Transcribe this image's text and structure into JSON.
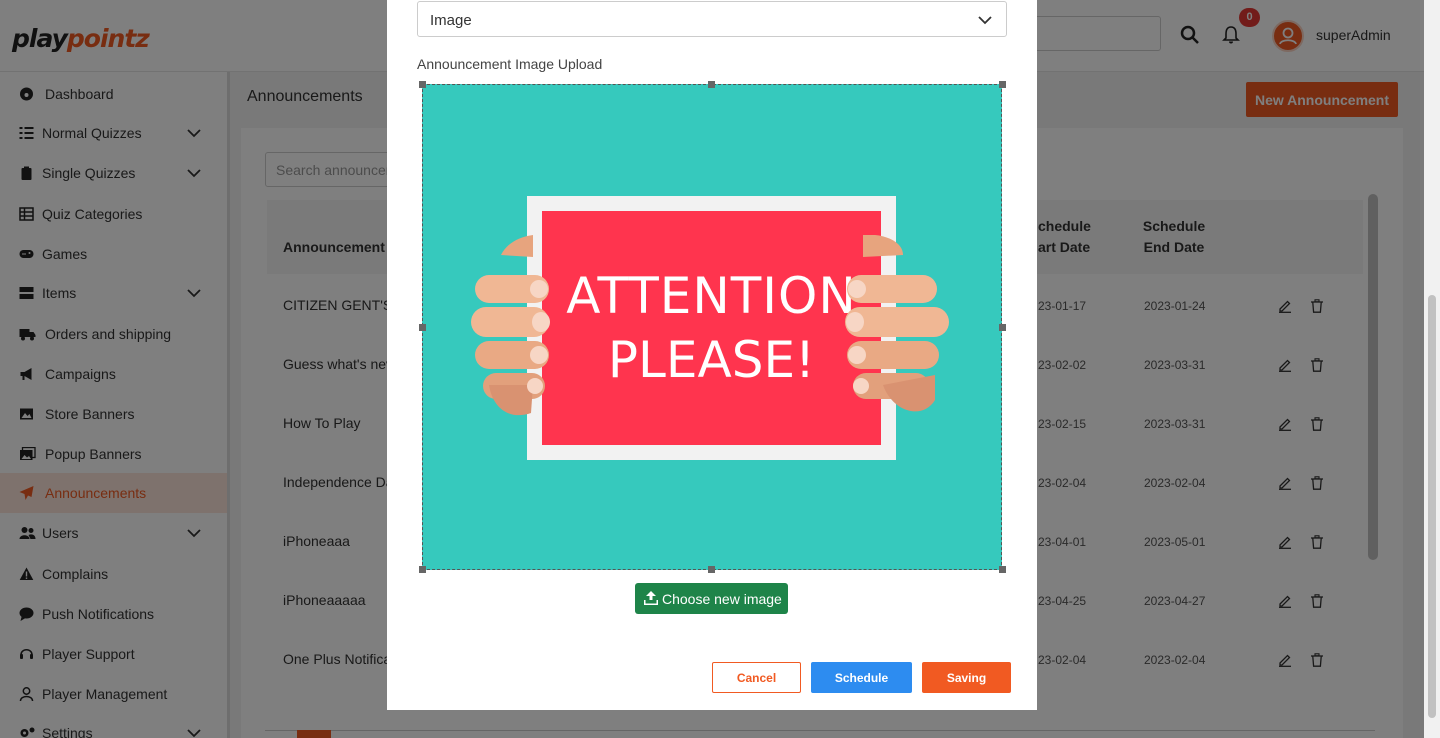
{
  "brand": {
    "play": "play",
    "pointz": "pointz"
  },
  "topbar": {
    "notification_count": "0",
    "username": "superAdmin",
    "search_icon": "search-icon",
    "bell_icon": "bell-icon",
    "avatar_icon": "user-avatar-icon"
  },
  "sidebar": {
    "items": [
      {
        "label": "Dashboard",
        "icon": "dashboard-icon",
        "expandable": false
      },
      {
        "label": "Normal Quizzes",
        "icon": "list-icon",
        "expandable": true
      },
      {
        "label": "Single Quizzes",
        "icon": "clipboard-icon",
        "expandable": true
      },
      {
        "label": "Quiz Categories",
        "icon": "table-icon",
        "expandable": false
      },
      {
        "label": "Games",
        "icon": "gamepad-icon",
        "expandable": false
      },
      {
        "label": "Items",
        "icon": "items-icon",
        "expandable": true
      },
      {
        "label": "Orders and shipping",
        "icon": "truck-icon",
        "expandable": false
      },
      {
        "label": "Campaigns",
        "icon": "megaphone-icon",
        "expandable": false
      },
      {
        "label": "Store Banners",
        "icon": "image-icon",
        "expandable": false
      },
      {
        "label": "Popup Banners",
        "icon": "images-icon",
        "expandable": false
      },
      {
        "label": "Announcements",
        "icon": "paper-plane-icon",
        "expandable": false,
        "active": true
      },
      {
        "label": "Users",
        "icon": "users-icon",
        "expandable": true
      },
      {
        "label": "Complains",
        "icon": "warning-icon",
        "expandable": false
      },
      {
        "label": "Push Notifications",
        "icon": "comment-icon",
        "expandable": false
      },
      {
        "label": "Player Support",
        "icon": "headset-icon",
        "expandable": false
      },
      {
        "label": "Player Management",
        "icon": "user-icon",
        "expandable": false
      },
      {
        "label": "Settings",
        "icon": "gears-icon",
        "expandable": true
      }
    ]
  },
  "page": {
    "title": "Announcements",
    "new_button": "New Announcement",
    "search_placeholder": "Search announcements"
  },
  "table": {
    "headers": {
      "name": "Announcement N",
      "start_l1": "chedule",
      "start_l2": "art Date",
      "end_l1": "Schedule",
      "end_l2": "End Date"
    },
    "rows": [
      {
        "name": "CITIZEN GENT'S",
        "start": "23-01-17",
        "end": "2023-01-24"
      },
      {
        "name": "Guess what's nev",
        "start": "23-02-02",
        "end": "2023-03-31"
      },
      {
        "name": "How To Play",
        "start": "23-02-15",
        "end": "2023-03-31"
      },
      {
        "name": "Independence Da",
        "start": "23-02-04",
        "end": "2023-02-04"
      },
      {
        "name": "iPhoneaaa",
        "start": "23-04-01",
        "end": "2023-05-01"
      },
      {
        "name": "iPhoneaaaaa",
        "start": "23-04-25",
        "end": "2023-04-27"
      },
      {
        "name": "One Plus Notifica",
        "start": "23-02-04",
        "end": "2023-02-04"
      }
    ]
  },
  "modal": {
    "type_select_value": "Image",
    "upload_label": "Announcement Image Upload",
    "image_text_line1": "ATTENTION",
    "image_text_line2": "PLEASE!",
    "choose_button": "Choose new image",
    "cancel_button": "Cancel",
    "schedule_button": "Schedule",
    "save_button": "Saving"
  },
  "colors": {
    "accent": "#f15a22",
    "teal": "#36c9bd",
    "sign_red": "#ff344e",
    "green": "#1e8449",
    "blue": "#2d8cf0"
  }
}
